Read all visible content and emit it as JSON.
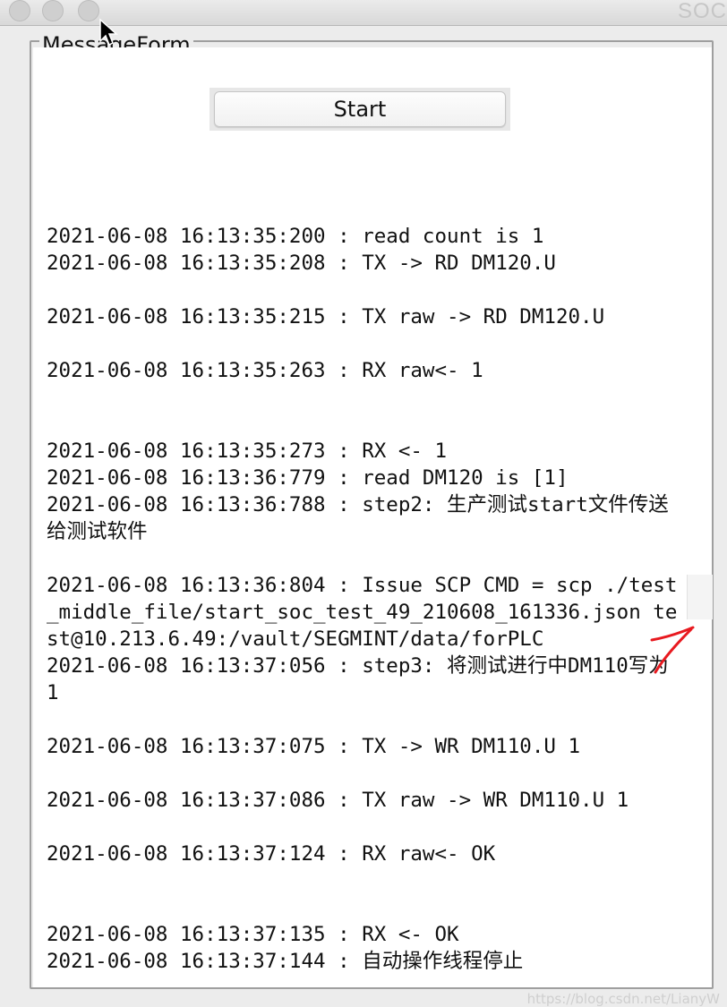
{
  "window": {
    "title": "SOC",
    "traffic_lights": [
      "close",
      "minimize",
      "zoom"
    ]
  },
  "form": {
    "group_title": "MessageForm",
    "start_button_label": "Start"
  },
  "log_lines": [
    "",
    "2021-06-08 16:13:35:200 : read count is 1",
    "2021-06-08 16:13:35:208 : TX -> RD DM120.U",
    "",
    "2021-06-08 16:13:35:215 : TX raw -> RD DM120.U",
    "",
    "2021-06-08 16:13:35:263 : RX raw<- 1",
    "",
    "",
    "2021-06-08 16:13:35:273 : RX <- 1",
    "2021-06-08 16:13:36:779 : read DM120 is [1]",
    "2021-06-08 16:13:36:788 : step2: 生产测试start文件传送给测试软件",
    "",
    "2021-06-08 16:13:36:804 : Issue SCP CMD = scp ./test_middle_file/start_soc_test_49_210608_161336.json test@10.213.6.49:/vault/SEGMINT/data/forPLC",
    "2021-06-08 16:13:37:056 : step3: 将测试进行中DM110写为1",
    "",
    "2021-06-08 16:13:37:075 : TX -> WR DM110.U 1",
    "",
    "2021-06-08 16:13:37:086 : TX raw -> WR DM110.U 1",
    "",
    "2021-06-08 16:13:37:124 : RX raw<- OK",
    "",
    "",
    "2021-06-08 16:13:37:135 : RX <- OK",
    "2021-06-08 16:13:37:144 : 自动操作线程停止"
  ],
  "annotation": {
    "arrow_color": "#e8191f"
  },
  "watermark": "https://blog.csdn.net/LianyW"
}
